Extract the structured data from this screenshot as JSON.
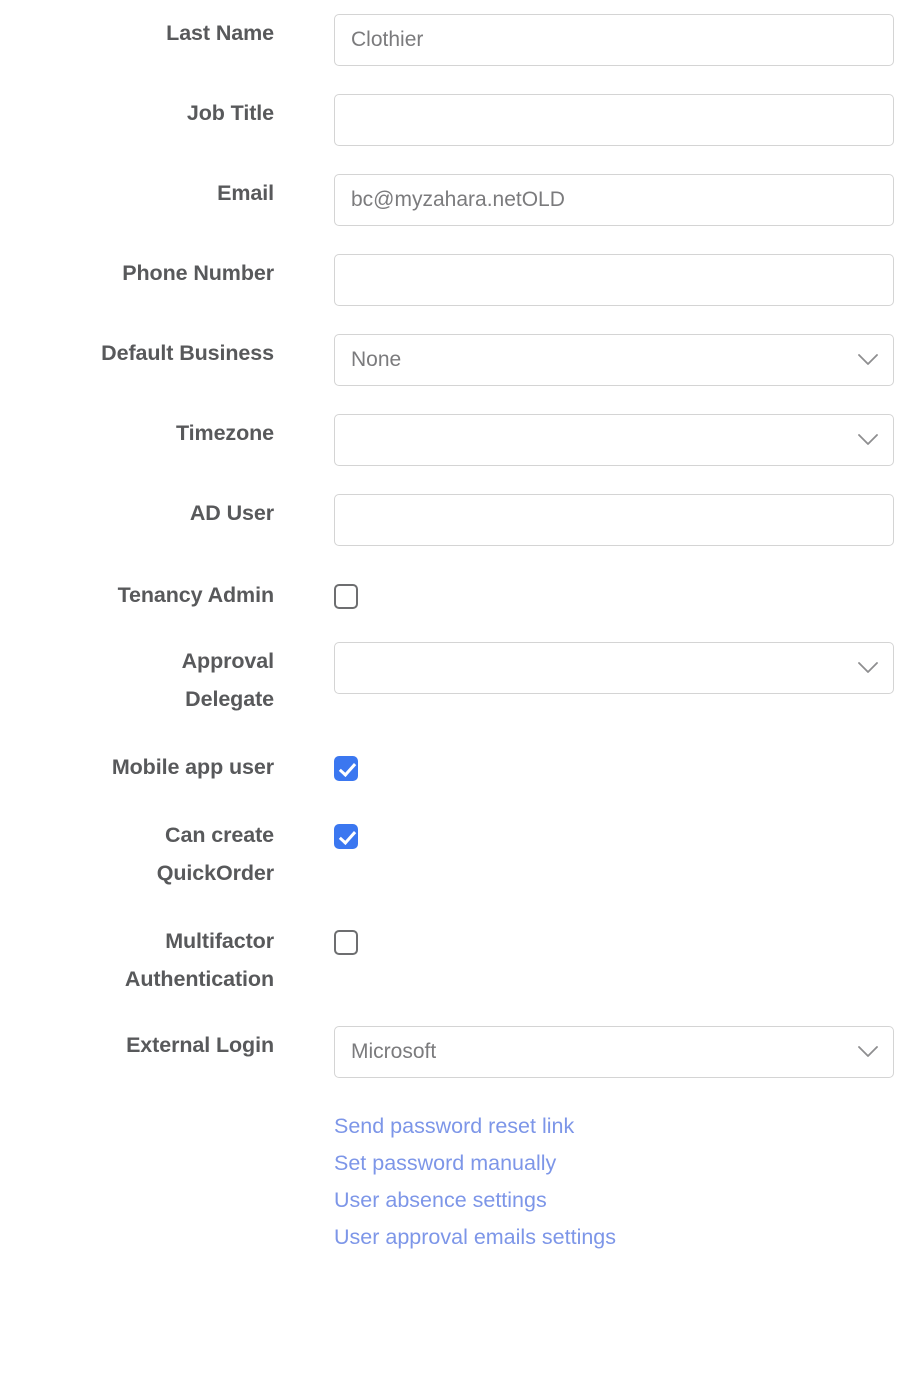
{
  "theme": {
    "label_color": "#58595b",
    "input_border": "#d4d4d4",
    "input_text": "#7b7b7d",
    "checkbox_checked": "#3b77f0",
    "checkbox_border": "#6d6e70",
    "link_color": "#7d96e8",
    "background": "#ffffff"
  },
  "form": {
    "fields": [
      {
        "name": "last-name",
        "label_lines": [
          "Last Name"
        ],
        "type": "text",
        "value": "Clothier",
        "placeholder": ""
      },
      {
        "name": "job-title",
        "label_lines": [
          "Job Title"
        ],
        "type": "text",
        "value": "",
        "placeholder": ""
      },
      {
        "name": "email",
        "label_lines": [
          "Email"
        ],
        "type": "text",
        "value": "bc@myzahara.netOLD",
        "placeholder": ""
      },
      {
        "name": "phone-number",
        "label_lines": [
          "Phone Number"
        ],
        "type": "text",
        "value": "",
        "placeholder": ""
      },
      {
        "name": "default-business",
        "label_lines": [
          "Default Business"
        ],
        "type": "select",
        "value": "None",
        "icon": "chevron-down-icon"
      },
      {
        "name": "timezone",
        "label_lines": [
          "Timezone"
        ],
        "type": "select",
        "value": "",
        "icon": "chevron-down-icon"
      },
      {
        "name": "ad-user",
        "label_lines": [
          "AD User"
        ],
        "type": "text",
        "value": "",
        "placeholder": ""
      },
      {
        "name": "tenancy-admin",
        "label_lines": [
          "Tenancy Admin"
        ],
        "type": "checkbox",
        "checked": false
      },
      {
        "name": "approval-delegate",
        "label_lines": [
          "Approval",
          "Delegate"
        ],
        "type": "select",
        "value": "",
        "icon": "chevron-down-icon"
      },
      {
        "name": "mobile-app-user",
        "label_lines": [
          "Mobile app user"
        ],
        "type": "checkbox",
        "checked": true
      },
      {
        "name": "can-create-quickorder",
        "label_lines": [
          "Can create",
          "QuickOrder"
        ],
        "type": "checkbox",
        "checked": true
      },
      {
        "name": "multifactor-authentication",
        "label_lines": [
          "Multifactor",
          "Authentication"
        ],
        "type": "checkbox",
        "checked": false
      },
      {
        "name": "external-login",
        "label_lines": [
          "External Login"
        ],
        "type": "select",
        "value": "Microsoft",
        "icon": "chevron-down-icon"
      }
    ],
    "links": [
      {
        "name": "send-password-reset-link",
        "label": "Send password reset link"
      },
      {
        "name": "set-password-manually",
        "label": "Set password manually"
      },
      {
        "name": "user-absence-settings",
        "label": "User absence settings"
      },
      {
        "name": "user-approval-emails-settings",
        "label": "User approval emails settings"
      }
    ]
  }
}
